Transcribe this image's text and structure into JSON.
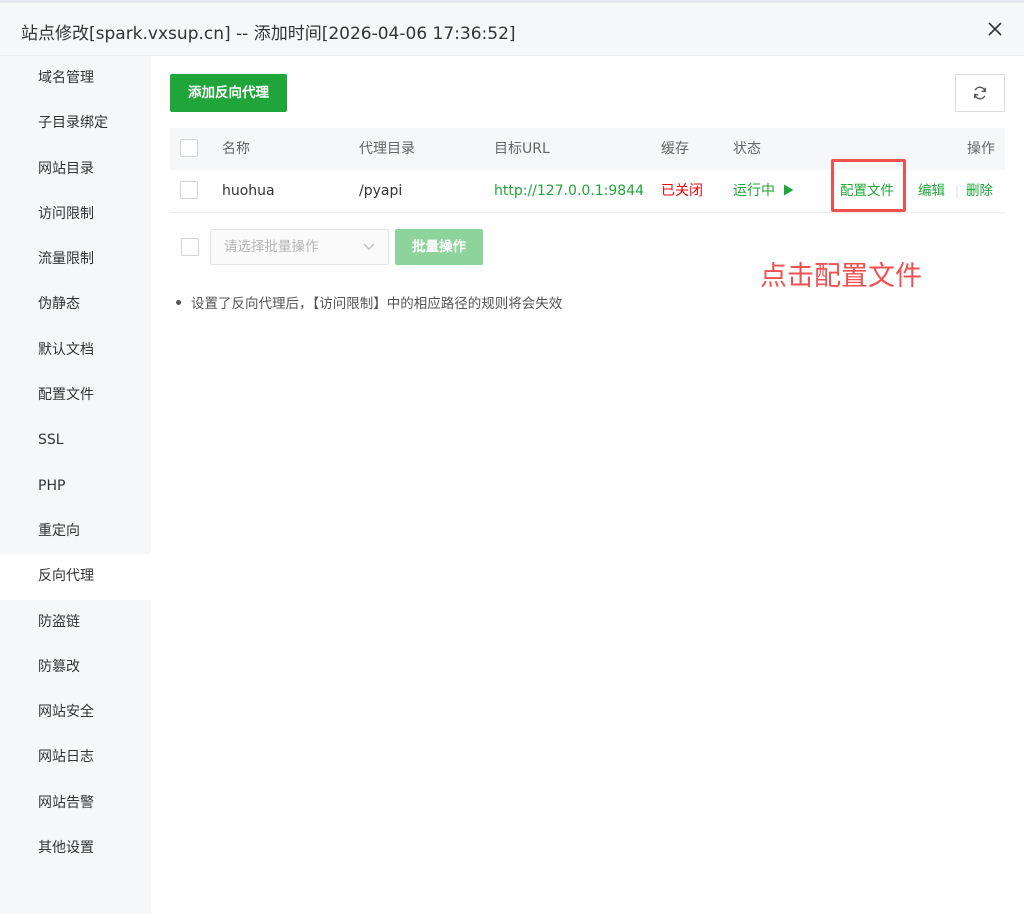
{
  "window": {
    "title": "站点修改[spark.vxsup.cn] -- 添加时间[2026-04-06 17:36:52]"
  },
  "sidebar": {
    "items": [
      {
        "label": "域名管理"
      },
      {
        "label": "子目录绑定"
      },
      {
        "label": "网站目录"
      },
      {
        "label": "访问限制"
      },
      {
        "label": "流量限制"
      },
      {
        "label": "伪静态"
      },
      {
        "label": "默认文档"
      },
      {
        "label": "配置文件"
      },
      {
        "label": "SSL"
      },
      {
        "label": "PHP"
      },
      {
        "label": "重定向"
      },
      {
        "label": "反向代理"
      },
      {
        "label": "防盗链"
      },
      {
        "label": "防篡改"
      },
      {
        "label": "网站安全"
      },
      {
        "label": "网站日志"
      },
      {
        "label": "网站告警"
      },
      {
        "label": "其他设置"
      }
    ],
    "active_index": 11
  },
  "toolbar": {
    "add_label": "添加反向代理"
  },
  "table": {
    "headers": {
      "name": "名称",
      "dir": "代理目录",
      "url": "目标URL",
      "cache": "缓存",
      "status": "状态",
      "actions": "操作"
    },
    "rows": [
      {
        "name": "huohua",
        "dir": "/pyapi",
        "url": "http://127.0.0.1:9844",
        "cache": "已关闭",
        "status": "运行中",
        "status_icon": "play-icon",
        "action_config": "配置文件",
        "action_edit": "编辑",
        "action_delete": "删除"
      }
    ]
  },
  "batch": {
    "placeholder": "请选择批量操作",
    "button": "批量操作"
  },
  "note": "设置了反向代理后，【访问限制】中的相应路径的规则将会失效",
  "annotation": "点击配置文件",
  "colors": {
    "primary": "#20a53a",
    "danger": "#ef0808",
    "annotation": "#f05050"
  }
}
